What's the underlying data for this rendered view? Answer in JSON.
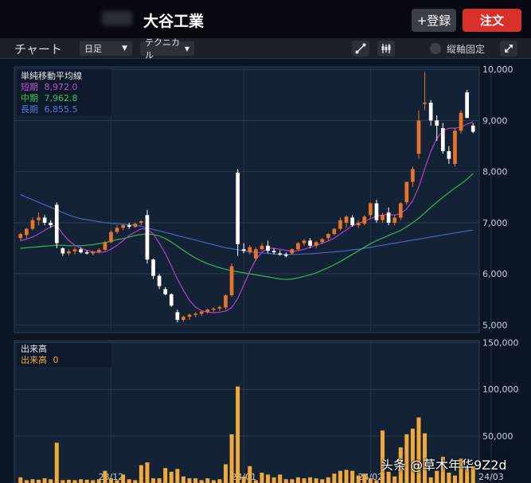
{
  "header": {
    "title": "大谷工業",
    "add_label": "+登録",
    "order_label": "注文"
  },
  "toolbar": {
    "title": "チャート",
    "period": "日足",
    "technical": "テクニカル",
    "fix_label": "縦軸固定",
    "icons": [
      "line-draw-icon",
      "compare-icon",
      "expand-icon"
    ]
  },
  "watermark": "头条 @草木年华9Z2d",
  "colors": {
    "up": "#e8742a",
    "down": "#ffffff",
    "short_ma": "#b540c8",
    "mid_ma": "#34b84c",
    "long_ma": "#4a62c8",
    "volume": "#f2a93b"
  },
  "chart_data": [
    {
      "type": "candlestick",
      "title": "単純移動平均線",
      "legend": [
        {
          "name": "短期",
          "value": "8,972.0"
        },
        {
          "name": "中期",
          "value": "7,962.8"
        },
        {
          "name": "長期",
          "value": "6,855.5"
        }
      ],
      "ylim": [
        4850,
        10050
      ],
      "yticks": [
        5000,
        6000,
        7000,
        8000,
        9000,
        10000
      ],
      "ytick_labels": [
        "5,000",
        "6,000",
        "7,000",
        "8,000",
        "9,000",
        "10,000"
      ],
      "x_tick_labels": [
        {
          "index": 15,
          "label": "23/12"
        },
        {
          "index": 37,
          "label": "24/01"
        },
        {
          "index": 58,
          "label": "24/02"
        },
        {
          "index": 78,
          "label": "24/03"
        }
      ],
      "ohlc": [
        [
          6700,
          6800,
          6650,
          6780
        ],
        [
          6760,
          6900,
          6700,
          6880
        ],
        [
          6880,
          7100,
          6850,
          7050
        ],
        [
          7050,
          7200,
          6950,
          7100
        ],
        [
          7100,
          7150,
          6950,
          7000
        ],
        [
          7000,
          7050,
          6900,
          6950
        ],
        [
          7350,
          7400,
          6500,
          6600
        ],
        [
          6500,
          6520,
          6350,
          6400
        ],
        [
          6400,
          6480,
          6360,
          6440
        ],
        [
          6440,
          6520,
          6380,
          6480
        ],
        [
          6480,
          6520,
          6400,
          6420
        ],
        [
          6420,
          6460,
          6380,
          6400
        ],
        [
          6400,
          6450,
          6360,
          6430
        ],
        [
          6430,
          6500,
          6400,
          6470
        ],
        [
          6470,
          6650,
          6450,
          6620
        ],
        [
          6620,
          6850,
          6600,
          6820
        ],
        [
          6820,
          6950,
          6780,
          6900
        ],
        [
          6900,
          6980,
          6850,
          6950
        ],
        [
          6950,
          7000,
          6880,
          6920
        ],
        [
          6920,
          7000,
          6900,
          6980
        ],
        [
          7000,
          7050,
          6950,
          7030
        ],
        [
          7150,
          7250,
          6200,
          6280
        ],
        [
          6280,
          6300,
          5900,
          5960
        ],
        [
          5960,
          6000,
          5700,
          5760
        ],
        [
          5700,
          5740,
          5580,
          5600
        ],
        [
          5600,
          5620,
          5350,
          5380
        ],
        [
          5250,
          5300,
          5050,
          5100
        ],
        [
          5100,
          5180,
          5060,
          5160
        ],
        [
          5160,
          5220,
          5100,
          5200
        ],
        [
          5200,
          5250,
          5150,
          5220
        ],
        [
          5220,
          5280,
          5180,
          5260
        ],
        [
          5260,
          5320,
          5220,
          5300
        ],
        [
          5300,
          5340,
          5260,
          5320
        ],
        [
          5320,
          5380,
          5280,
          5350
        ],
        [
          5340,
          5600,
          5300,
          5580
        ],
        [
          5580,
          6200,
          5550,
          6150
        ],
        [
          7980,
          8050,
          6350,
          6580
        ],
        [
          6480,
          6600,
          6400,
          6450
        ],
        [
          6420,
          6560,
          6380,
          6520
        ],
        [
          6300,
          6520,
          6250,
          6480
        ],
        [
          6480,
          6600,
          6450,
          6550
        ],
        [
          6550,
          6650,
          6400,
          6450
        ],
        [
          6450,
          6500,
          6380,
          6420
        ],
        [
          6400,
          6460,
          6350,
          6380
        ],
        [
          6380,
          6420,
          6320,
          6350
        ],
        [
          6400,
          6500,
          6380,
          6480
        ],
        [
          6480,
          6620,
          6450,
          6600
        ],
        [
          6600,
          6680,
          6550,
          6650
        ],
        [
          6650,
          6700,
          6500,
          6550
        ],
        [
          6550,
          6650,
          6500,
          6620
        ],
        [
          6620,
          6700,
          6580,
          6680
        ],
        [
          6700,
          6800,
          6650,
          6780
        ],
        [
          6780,
          6900,
          6750,
          6880
        ],
        [
          6880,
          7100,
          6850,
          7050
        ],
        [
          7000,
          7150,
          6900,
          7120
        ],
        [
          7100,
          7150,
          6920,
          6950
        ],
        [
          6950,
          7050,
          6900,
          7000
        ],
        [
          6980,
          7150,
          6950,
          7120
        ],
        [
          7150,
          7400,
          7100,
          7380
        ],
        [
          7380,
          7450,
          7000,
          7050
        ],
        [
          7050,
          7200,
          7000,
          7150
        ],
        [
          7200,
          7300,
          6950,
          7000
        ],
        [
          7000,
          7150,
          6950,
          7100
        ],
        [
          7100,
          7400,
          7050,
          7380
        ],
        [
          7400,
          7800,
          7350,
          7800
        ],
        [
          7800,
          8100,
          7700,
          8050
        ],
        [
          8350,
          9200,
          8250,
          9000
        ],
        [
          9350,
          9950,
          9200,
          9350
        ],
        [
          9350,
          9400,
          8900,
          9000
        ],
        [
          9000,
          9100,
          8600,
          8900
        ],
        [
          8850,
          8950,
          8350,
          8400
        ],
        [
          8400,
          8500,
          8150,
          8250
        ],
        [
          8150,
          8850,
          8100,
          8800
        ],
        [
          8800,
          9200,
          8750,
          9150
        ],
        [
          9550,
          9600,
          9050,
          9050
        ],
        [
          8900,
          8950,
          8750,
          8780
        ]
      ],
      "ma_short": [
        6650,
        6680,
        6720,
        6780,
        6850,
        6920,
        6950,
        6780,
        6650,
        6560,
        6500,
        6460,
        6430,
        6420,
        6430,
        6480,
        6560,
        6650,
        6750,
        6820,
        6880,
        6880,
        6780,
        6600,
        6400,
        6150,
        5900,
        5680,
        5480,
        5350,
        5280,
        5250,
        5240,
        5250,
        5270,
        5340,
        5520,
        5780,
        6050,
        6280,
        6420,
        6500,
        6500,
        6480,
        6460,
        6440,
        6450,
        6480,
        6520,
        6560,
        6600,
        6640,
        6700,
        6780,
        6860,
        6940,
        6990,
        7030,
        7080,
        7130,
        7150,
        7160,
        7150,
        7180,
        7270,
        7430,
        7700,
        8060,
        8400,
        8650,
        8800,
        8850,
        8850,
        8870,
        8930,
        8972
      ],
      "ma_mid": [
        6500,
        6510,
        6520,
        6530,
        6540,
        6550,
        6560,
        6560,
        6550,
        6550,
        6550,
        6560,
        6570,
        6590,
        6610,
        6640,
        6670,
        6690,
        6720,
        6750,
        6770,
        6780,
        6770,
        6740,
        6690,
        6620,
        6540,
        6460,
        6380,
        6310,
        6250,
        6200,
        6160,
        6120,
        6090,
        6060,
        6040,
        6020,
        6000,
        5980,
        5960,
        5940,
        5920,
        5900,
        5890,
        5900,
        5920,
        5950,
        5980,
        6020,
        6070,
        6120,
        6180,
        6240,
        6310,
        6380,
        6450,
        6520,
        6590,
        6650,
        6700,
        6750,
        6800,
        6850,
        6920,
        7000,
        7090,
        7190,
        7300,
        7400,
        7500,
        7590,
        7680,
        7760,
        7850,
        7962.8
      ],
      "ma_long": [
        7550,
        7500,
        7450,
        7400,
        7350,
        7300,
        7250,
        7200,
        7150,
        7110,
        7080,
        7060,
        7040,
        7020,
        7000,
        6990,
        6980,
        6970,
        6960,
        6950,
        6930,
        6900,
        6870,
        6840,
        6810,
        6780,
        6750,
        6720,
        6690,
        6660,
        6630,
        6600,
        6570,
        6540,
        6510,
        6490,
        6470,
        6450,
        6430,
        6420,
        6410,
        6400,
        6390,
        6380,
        6380,
        6380,
        6380,
        6390,
        6390,
        6400,
        6410,
        6420,
        6430,
        6440,
        6450,
        6470,
        6480,
        6500,
        6520,
        6540,
        6560,
        6580,
        6600,
        6620,
        6640,
        6660,
        6680,
        6700,
        6720,
        6740,
        6760,
        6780,
        6800,
        6820,
        6840,
        6855.5
      ]
    },
    {
      "type": "bar",
      "title": "出来高",
      "legend": [
        {
          "name": "出来高",
          "value": "0"
        }
      ],
      "ylim": [
        0,
        152000
      ],
      "yticks": [
        50000,
        100000,
        150000
      ],
      "ytick_labels": [
        "50,000",
        "100,000",
        "150,000"
      ],
      "values": [
        6000,
        3000,
        4000,
        3500,
        5000,
        4000,
        43000,
        3000,
        3500,
        3000,
        4000,
        3500,
        3000,
        4000,
        13000,
        5000,
        3000,
        9000,
        4000,
        3000,
        19000,
        22000,
        5000,
        5000,
        16000,
        12000,
        15000,
        7000,
        5000,
        5000,
        3000,
        5000,
        3000,
        4000,
        20000,
        52000,
        103000,
        7000,
        18000,
        3000,
        11000,
        9000,
        6000,
        9000,
        4000,
        4000,
        6000,
        5000,
        6000,
        5000,
        4000,
        6000,
        10000,
        13000,
        14000,
        13000,
        8000,
        10000,
        5000,
        3000,
        56000,
        12000,
        7000,
        38000,
        52000,
        58000,
        70000,
        53000,
        6000,
        13000,
        28000,
        11000,
        8000,
        26000,
        16000,
        18000
      ]
    }
  ]
}
